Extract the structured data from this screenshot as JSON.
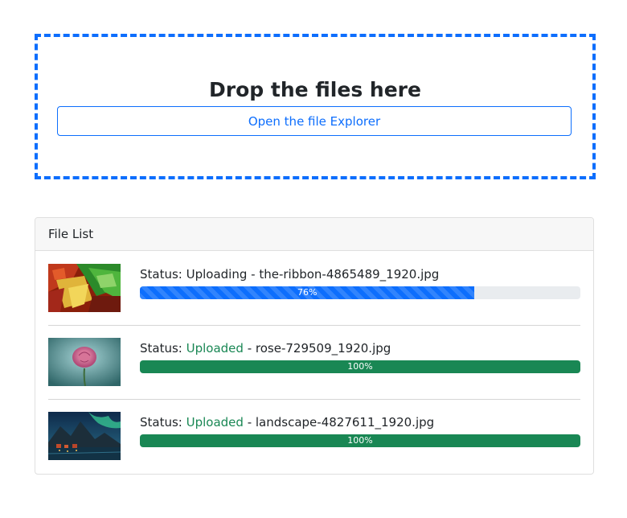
{
  "dropzone": {
    "title": "Drop the files here",
    "button_label": "Open the file Explorer"
  },
  "file_list": {
    "header": "File List",
    "items": [
      {
        "status_prefix": "Status: ",
        "status": "Uploading",
        "separator": " - ",
        "filename": "the-ribbon-4865489_1920.jpg",
        "progress": 76,
        "progress_label": "76%",
        "thumbnail": "ribbon-image"
      },
      {
        "status_prefix": "Status: ",
        "status": "Uploaded",
        "separator": " - ",
        "filename": "rose-729509_1920.jpg",
        "progress": 100,
        "progress_label": "100%",
        "thumbnail": "rose-image"
      },
      {
        "status_prefix": "Status: ",
        "status": "Uploaded",
        "separator": " - ",
        "filename": "landscape-4827611_1920.jpg",
        "progress": 100,
        "progress_label": "100%",
        "thumbnail": "landscape-image"
      }
    ]
  },
  "colors": {
    "primary": "#0d6efd",
    "success": "#198754"
  }
}
